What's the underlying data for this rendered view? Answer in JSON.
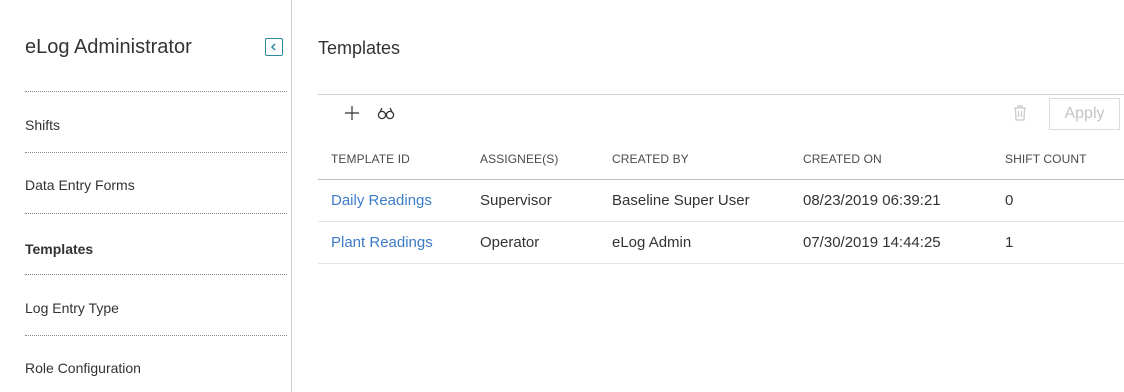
{
  "sidebar": {
    "title": "eLog Administrator",
    "items": [
      {
        "label": "Shifts"
      },
      {
        "label": "Data Entry Forms"
      },
      {
        "label": "Templates"
      },
      {
        "label": "Log Entry Type"
      },
      {
        "label": "Role Configuration"
      }
    ],
    "active_item": "Templates"
  },
  "main": {
    "title": "Templates",
    "toolbar": {
      "add_icon": "plus-icon",
      "search_icon": "binoculars-icon",
      "delete_icon": "trash-icon",
      "apply_label": "Apply"
    },
    "table": {
      "columns": [
        "TEMPLATE ID",
        "ASSIGNEE(S)",
        "CREATED BY",
        "CREATED ON",
        "SHIFT COUNT"
      ],
      "rows": [
        {
          "template_id": "Daily Readings",
          "assignee": "Supervisor",
          "created_by": "Baseline Super User",
          "created_on": "08/23/2019 06:39:21",
          "shift_count": "0"
        },
        {
          "template_id": "Plant Readings",
          "assignee": "Operator",
          "created_by": "eLog Admin",
          "created_on": "07/30/2019 14:44:25",
          "shift_count": "1"
        }
      ]
    }
  },
  "colors": {
    "link": "#3d7cc9",
    "accent": "#2d8a9c",
    "disabled": "#c3c3c3"
  }
}
